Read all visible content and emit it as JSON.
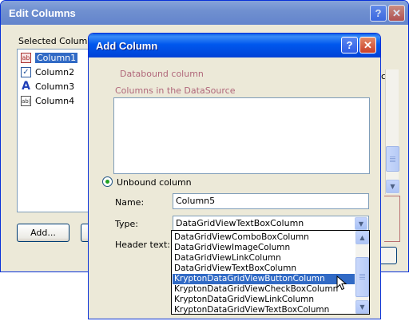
{
  "edit_window": {
    "title": "Edit Columns",
    "selected_columns_label": "Selected Columns:",
    "columns": [
      {
        "label": "Column1",
        "icon": "button-column-icon",
        "selected": true
      },
      {
        "label": "Column2",
        "icon": "checkbox-column-icon",
        "selected": false
      },
      {
        "label": "Column3",
        "icon": "link-column-icon",
        "selected": false
      },
      {
        "label": "Column4",
        "icon": "textbox-column-icon",
        "selected": false
      }
    ],
    "add_button": "Add...",
    "right_partial_char": "c",
    "help_glyph": "?",
    "close_glyph": "✕"
  },
  "add_dialog": {
    "title": "Add Column",
    "help_glyph": "?",
    "close_glyph": "✕",
    "databound_label": "Databound column",
    "datasource_label": "Columns in the DataSource",
    "unbound_label": "Unbound column",
    "unbound_selected": true,
    "name_label": "Name:",
    "name_value": "Column5",
    "type_label": "Type:",
    "type_value": "DataGridViewTextBoxColumn",
    "header_text_label": "Header text:",
    "type_options": [
      "DataGridViewComboBoxColumn",
      "DataGridViewImageColumn",
      "DataGridViewLinkColumn",
      "DataGridViewTextBoxColumn",
      "KryptonDataGridViewButtonColumn",
      "KryptonDataGridViewCheckBoxColumn",
      "KryptonDataGridViewLinkColumn",
      "KryptonDataGridViewTextBoxColumn"
    ],
    "highlighted_option_index": 4
  },
  "colors": {
    "titlebar_active": "#0054e3",
    "titlebar_inactive": "#7a96df",
    "selection": "#316ac5",
    "disabled_text": "#b0677a",
    "dialog_bg": "#ece9d8"
  }
}
